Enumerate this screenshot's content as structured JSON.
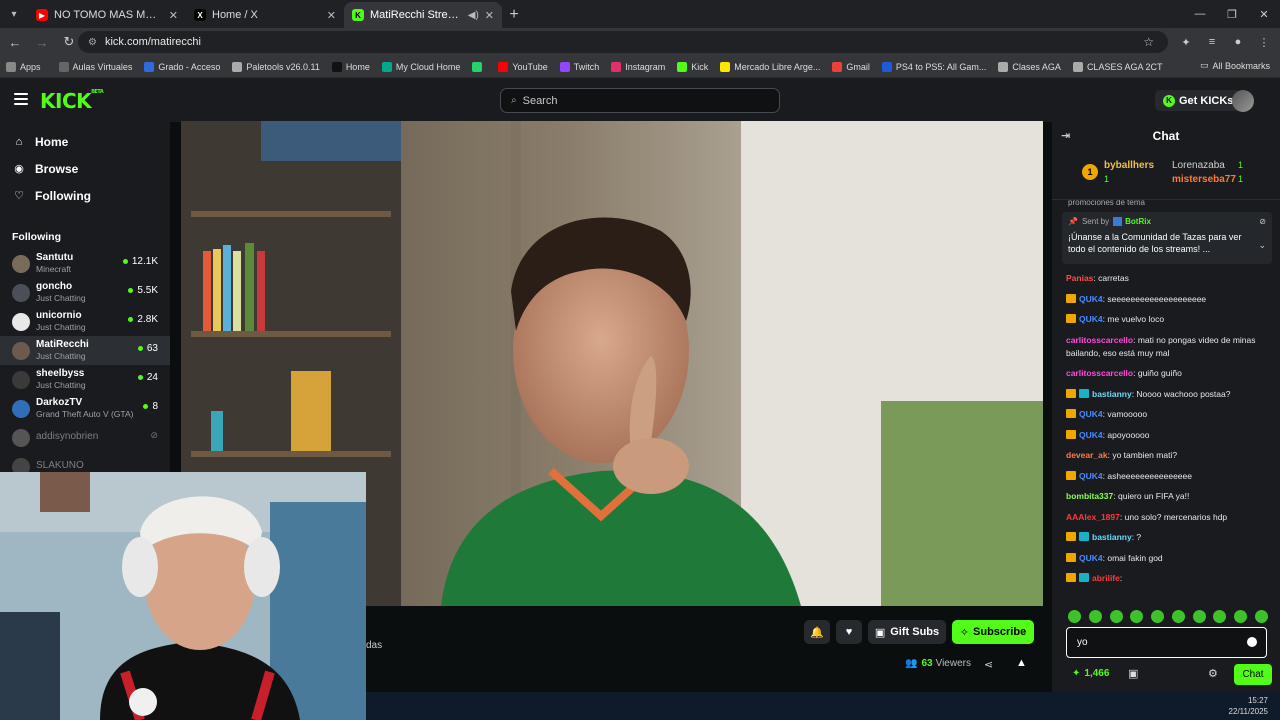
{
  "browser": {
    "tabs": [
      {
        "title": "NO TOMO MAS MATE #memu",
        "favicon": "youtube-favicon",
        "color": "#ff0000",
        "active": false
      },
      {
        "title": "Home / X",
        "favicon": "x-favicon",
        "color": "#000000",
        "active": false
      },
      {
        "title": "MatiRecchi Stream - Watch",
        "favicon": "kick-favicon",
        "color": "#53fc18",
        "active": true
      }
    ],
    "url": "kick.com/matirecchi",
    "bookmarks": [
      "Apps",
      "Aulas Virtuales",
      "Grado - Acceso",
      "Paletools v26.0.11",
      "Home",
      "My Cloud Home",
      "YouTube",
      "Twitch",
      "Instagram",
      "Kick",
      "Mercado Libre Arge...",
      "Gmail",
      "PS4 to PS5: All Gam...",
      "Clases AGA",
      "CLASES AGA 2CT"
    ],
    "all_bookmarks": "All Bookmarks"
  },
  "kick": {
    "logo": "KICK",
    "logo_sup": "BETA",
    "search_placeholder": "Search",
    "get_kicks": "Get KICKs",
    "nav": [
      {
        "label": "Home",
        "icon": "home-icon"
      },
      {
        "label": "Browse",
        "icon": "compass-icon"
      },
      {
        "label": "Following",
        "icon": "heart-icon"
      }
    ],
    "following_title": "Following",
    "following": [
      {
        "name": "Santutu",
        "category": "Minecraft",
        "viewers": "12.1K",
        "live": true
      },
      {
        "name": "goncho",
        "category": "Just Chatting",
        "viewers": "5.5K",
        "live": true
      },
      {
        "name": "unicornio",
        "category": "Just Chatting",
        "viewers": "2.8K",
        "live": true
      },
      {
        "name": "MatiRecchi",
        "category": "Just Chatting",
        "viewers": "63",
        "live": true,
        "active": true
      },
      {
        "name": "sheelbyss",
        "category": "Just Chatting",
        "viewers": "24",
        "live": true
      },
      {
        "name": "DarkozTV",
        "category": "Grand Theft Auto V (GTA)",
        "viewers": "8",
        "live": true
      },
      {
        "name": "addisynobrien",
        "category": "",
        "viewers": "",
        "live": false
      },
      {
        "name": "SLAKUNO",
        "category": "",
        "viewers": "",
        "live": false
      }
    ]
  },
  "stream": {
    "gift_subs": "Gift Subs",
    "subscribe": "Subscribe",
    "viewers_count": "63",
    "viewers_label": "Viewers",
    "partial_text": "das"
  },
  "chat": {
    "title": "Chat",
    "gifters": [
      {
        "name": "byballhers",
        "count": "1"
      },
      {
        "name": "Lorenazaba",
        "count": "1"
      },
      {
        "name": "misterseba77",
        "count": "1"
      }
    ],
    "truncated_top": "promociones de tema",
    "pinned": {
      "sent_by_label": "Sent by",
      "sender": "BotRix",
      "text": "¡Únanse a la Comunidad de Tazas para ver todo el contenido de los streams! ..."
    },
    "messages": [
      {
        "user": "Panias",
        "color": "#ff4b4b",
        "text": "carretas",
        "badge": ""
      },
      {
        "user": "QUK4",
        "color": "#4b8bff",
        "text": "seeeeeeeeeeeeeeeeeeee",
        "badge": "gold"
      },
      {
        "user": "QUK4",
        "color": "#4b8bff",
        "text": "me vuelvo loco",
        "badge": "gold"
      },
      {
        "user": "carlitosscarcello",
        "color": "#ff4bd8",
        "text": "mati no pongas video de minas bailando, eso está muy mal",
        "badge": ""
      },
      {
        "user": "carlitosscarcello",
        "color": "#ff4bd8",
        "text": "guiño guiño",
        "badge": ""
      },
      {
        "user": "bastianny",
        "color": "#6bdcff",
        "text": "Noooo wachooo postaa?",
        "badge": "both"
      },
      {
        "user": "QUK4",
        "color": "#4b8bff",
        "text": "vamooooo",
        "badge": "gold"
      },
      {
        "user": "QUK4",
        "color": "#4b8bff",
        "text": "apoyooooo",
        "badge": "gold"
      },
      {
        "user": "devear_ak",
        "color": "#ff7b4b",
        "text": "yo tambien mati?",
        "badge": ""
      },
      {
        "user": "QUK4",
        "color": "#4b8bff",
        "text": "asheeeeeeeeeeeeeee",
        "badge": "gold"
      },
      {
        "user": "bombita337",
        "color": "#8bff4b",
        "text": "quiero un FIFA ya!!",
        "badge": ""
      },
      {
        "user": "AAAlex_1897",
        "color": "#ff3b3b",
        "text": "uno solo? mercenarios hdp",
        "badge": ""
      },
      {
        "user": "bastianny",
        "color": "#6bdcff",
        "text": "?",
        "badge": "both"
      },
      {
        "user": "QUK4",
        "color": "#4b8bff",
        "text": "omai fakin god",
        "badge": "gold"
      },
      {
        "user": "abrilife",
        "color": "#ff3b3b",
        "text": "",
        "badge": "both"
      }
    ],
    "input_value": "yo",
    "points": "1,466",
    "send_label": "Chat"
  },
  "taskbar": {
    "time": "15:27",
    "date": "22/11/2025"
  }
}
